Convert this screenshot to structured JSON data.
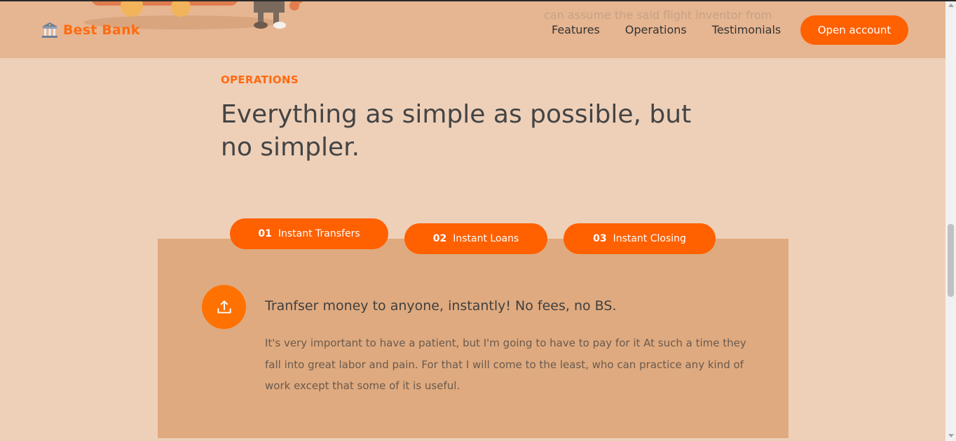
{
  "header": {
    "logo_text": "Best Bank",
    "ghost_text": "can assume the said flight inventor from",
    "nav": [
      {
        "label": "Features"
      },
      {
        "label": "Operations"
      },
      {
        "label": "Testimonials"
      }
    ],
    "cta_label": "Open account"
  },
  "section": {
    "label": "OPERATIONS",
    "title": "Everything as simple as possible, but no simpler."
  },
  "tabs": [
    {
      "num": "01",
      "label": "Instant Transfers",
      "active": true
    },
    {
      "num": "02",
      "label": "Instant Loans",
      "active": false
    },
    {
      "num": "03",
      "label": "Instant Closing",
      "active": false
    }
  ],
  "content": {
    "icon": "upload-icon",
    "title": "Tranfser money to anyone, instantly! No fees, no BS.",
    "text": "It's very important to have a patient, but I'm going to have to pay for it At such a time they fall into great labor and pain. For that I will come to the least, who can practice any kind of work except that some of it is useful."
  },
  "colors": {
    "accent": "#ff6000",
    "header_bg": "#e6b591",
    "page_bg": "#eed0b9",
    "panel_bg": "#dfaa7f"
  }
}
